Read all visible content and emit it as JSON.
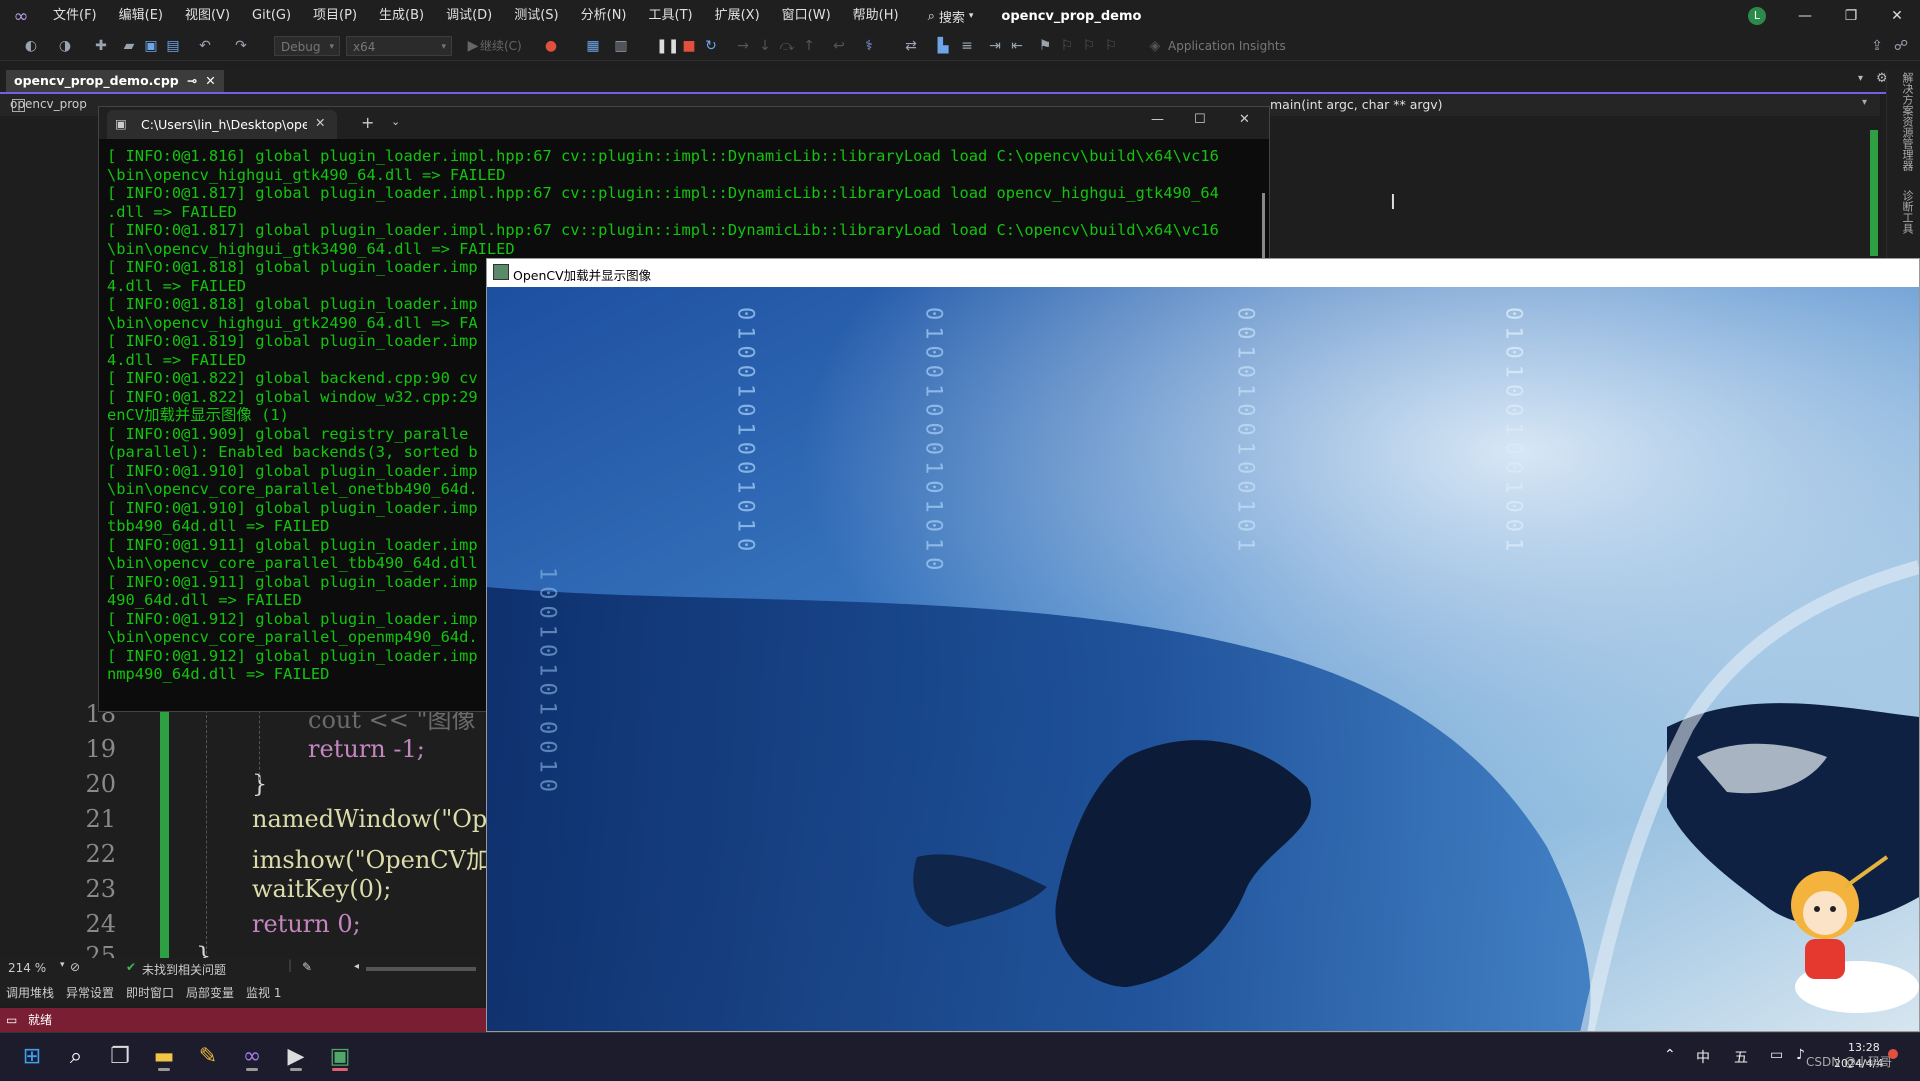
{
  "title_bar": {
    "menus": [
      "文件(F)",
      "编辑(E)",
      "视图(V)",
      "Git(G)",
      "项目(P)",
      "生成(B)",
      "调试(D)",
      "测试(S)",
      "分析(N)",
      "工具(T)",
      "扩展(X)",
      "窗口(W)",
      "帮助(H)"
    ],
    "search_label": "搜索",
    "solution_name": "opencv_prop_demo",
    "account_initial": "L"
  },
  "toolbar": {
    "configuration": "Debug",
    "platform": "x64",
    "continue_label": "继续(C)",
    "app_insights": "Application Insights"
  },
  "doc_tab": {
    "name": "opencv_prop_demo.cpp",
    "pin": "⊸",
    "close": "✕"
  },
  "editor_nav": {
    "file_dropdown": "opencv_prop",
    "function_dropdown": "main(int argc, char ** argv)"
  },
  "editor": {
    "line_numbers_partial": [
      "1",
      "1",
      "1",
      "1",
      "1",
      "1",
      "1"
    ],
    "lines": [
      {
        "num": "18",
        "code": "cout << \"图像"
      },
      {
        "num": "19",
        "code": "return -1;"
      },
      {
        "num": "20",
        "code": "}"
      },
      {
        "num": "21",
        "code": "namedWindow(\"Open"
      },
      {
        "num": "22",
        "code": "imshow(\"OpenCV加载"
      },
      {
        "num": "23",
        "code": "waitKey(0);"
      },
      {
        "num": "24",
        "code": "return 0;"
      },
      {
        "num": "25",
        "code": "}"
      }
    ],
    "zoom": "214 %",
    "issues": "未找到相关问题"
  },
  "bottom_tabs": [
    "调用堆栈",
    "异常设置",
    "即时窗口",
    "局部变量",
    "监视 1"
  ],
  "status_bar": {
    "text": "就绪"
  },
  "right_rail": [
    "解决方案资源管理器",
    "诊断工具"
  ],
  "console": {
    "tab_title": "C:\\Users\\lin_h\\Desktop\\openc",
    "lines": [
      "[ INFO:0@1.816] global plugin_loader.impl.hpp:67 cv::plugin::impl::DynamicLib::libraryLoad load C:\\opencv\\build\\x64\\vc16",
      "\\bin\\opencv_highgui_gtk490_64.dll => FAILED",
      "[ INFO:0@1.817] global plugin_loader.impl.hpp:67 cv::plugin::impl::DynamicLib::libraryLoad load opencv_highgui_gtk490_64",
      ".dll => FAILED",
      "[ INFO:0@1.817] global plugin_loader.impl.hpp:67 cv::plugin::impl::DynamicLib::libraryLoad load C:\\opencv\\build\\x64\\vc16",
      "\\bin\\opencv_highgui_gtk3490_64.dll => FAILED",
      "[ INFO:0@1.818] global plugin_loader.imp",
      "4.dll => FAILED",
      "[ INFO:0@1.818] global plugin_loader.imp",
      "\\bin\\opencv_highgui_gtk2490_64.dll => FA",
      "[ INFO:0@1.819] global plugin_loader.imp",
      "4.dll => FAILED",
      "[ INFO:0@1.822] global backend.cpp:90 cv",
      "[ INFO:0@1.822] global window_w32.cpp:29",
      "enCV加载并显示图像 (1)",
      "[ INFO:0@1.909] global registry_paralle",
      "(parallel): Enabled backends(3, sorted b",
      "[ INFO:0@1.910] global plugin_loader.imp",
      "\\bin\\opencv_core_parallel_onetbb490_64d.",
      "[ INFO:0@1.910] global plugin_loader.imp",
      "tbb490_64d.dll => FAILED",
      "[ INFO:0@1.911] global plugin_loader.imp",
      "\\bin\\opencv_core_parallel_tbb490_64d.dll",
      "[ INFO:0@1.911] global plugin_loader.imp",
      "490_64d.dll => FAILED",
      "[ INFO:0@1.912] global plugin_loader.imp",
      "\\bin\\opencv_core_parallel_openmp490_64d.",
      "[ INFO:0@1.912] global plugin_loader.imp",
      "nmp490_64d.dll => FAILED"
    ]
  },
  "image_window": {
    "title": "OpenCV加载并显示图像",
    "binary_columns": [
      "0100101001010",
      "01001000101010",
      "0010100100101",
      "0101001001001",
      "100101010010"
    ]
  },
  "taskbar": {
    "clock_time": "13:28",
    "clock_date": "2024/4/4",
    "ime_lang": "中",
    "ime_mode": "五",
    "watermark": "CSDN @小码哥"
  },
  "colors": {
    "console_text": "#13c40e",
    "status_bar": "#7a1e33",
    "accent": "#7160e8"
  }
}
